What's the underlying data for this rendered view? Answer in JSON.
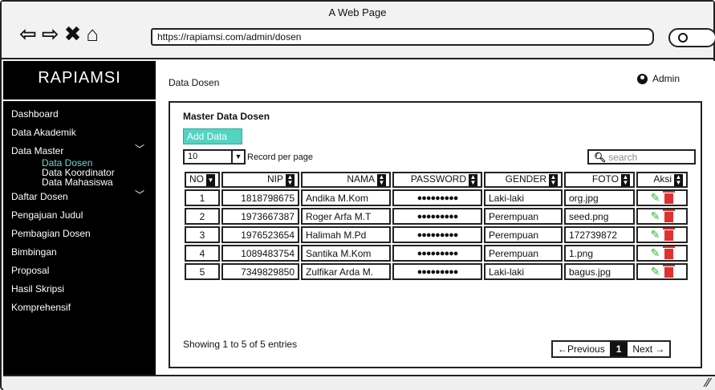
{
  "window": {
    "title": "A Web Page",
    "url": "https://rapiamsi.com/admin/dosen"
  },
  "brand": "RAPIAMSI",
  "menu": [
    {
      "label": "Dashboard"
    },
    {
      "label": "Data Akademik"
    },
    {
      "label": "Data Master",
      "sub": [
        "Data Dosen",
        "Data Koordinator",
        "Data Mahasiswa"
      ]
    },
    {
      "label": "Daftar Dosen"
    },
    {
      "label": "Pengajuan Judul"
    },
    {
      "label": "Pembagian Dosen"
    },
    {
      "label": "Bimbingan"
    },
    {
      "label": "Proposal"
    },
    {
      "label": "Hasil Skripsi"
    },
    {
      "label": "Komprehensif"
    }
  ],
  "header": {
    "breadcrumb": "Data Dosen",
    "user": "Admin"
  },
  "card": {
    "title": "Master Data Dosen",
    "add_label": "Add Data",
    "per_page_value": "10",
    "per_page_label": "Record per page",
    "search_placeholder": "search"
  },
  "table": {
    "columns": [
      "NO",
      "NIP",
      "NAMA",
      "PASSWORD",
      "GENDER",
      "FOTO",
      "Aksi"
    ],
    "rows": [
      [
        "1",
        "1818798675",
        "Andika M.Kom",
        "●●●●●●●●●",
        "Laki-laki",
        "org.jpg"
      ],
      [
        "2",
        "1973667387",
        "Roger Arfa M.T",
        "●●●●●●●●●",
        "Perempuan",
        "seed.png"
      ],
      [
        "3",
        "1976523654",
        "Halimah M.Pd",
        "●●●●●●●●●",
        "Perempuan",
        "172739872"
      ],
      [
        "4",
        "1089483754",
        "Santika M.Kom",
        "●●●●●●●●●",
        "Perempuan",
        "1.png"
      ],
      [
        "5",
        "7349829850",
        "Zulfikar Arda M.",
        "●●●●●●●●●",
        "Laki-laki",
        "bagus.jpg"
      ]
    ]
  },
  "footer": {
    "entries": "Showing 1 to 5 of 5 entries",
    "prev": "←Previous",
    "page": "1",
    "next": "Next →"
  }
}
